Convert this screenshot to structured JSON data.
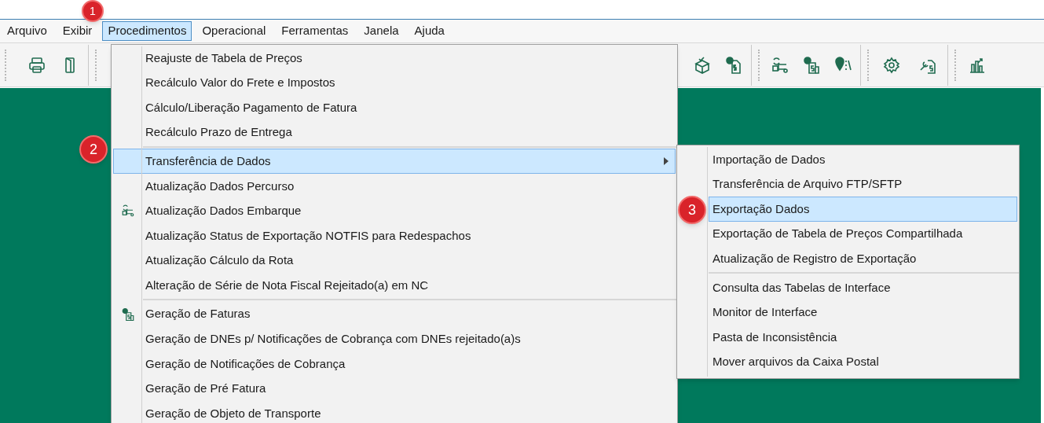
{
  "menu_bar": [
    {
      "label": "Arquivo",
      "selected": false
    },
    {
      "label": "Exibir",
      "selected": false
    },
    {
      "label": "Procedimentos",
      "selected": true
    },
    {
      "label": "Operacional",
      "selected": false
    },
    {
      "label": "Ferramentas",
      "selected": false
    },
    {
      "label": "Janela",
      "selected": false
    },
    {
      "label": "Ajuda",
      "selected": false
    }
  ],
  "menu": {
    "items": [
      {
        "kind": "item",
        "label": "Reajuste de Tabela de Preços",
        "selected": false,
        "has_icon": false,
        "submenu": false
      },
      {
        "kind": "item",
        "label": "Recálculo Valor do Frete e Impostos",
        "selected": false,
        "has_icon": false,
        "submenu": false
      },
      {
        "kind": "item",
        "label": "Cálculo/Liberação Pagamento de Fatura",
        "selected": false,
        "has_icon": false,
        "submenu": false
      },
      {
        "kind": "item",
        "label": "Recálculo Prazo de Entrega",
        "selected": false,
        "has_icon": false,
        "submenu": false
      },
      {
        "kind": "separator"
      },
      {
        "kind": "item",
        "label": "Transferência de Dados",
        "selected": true,
        "has_icon": false,
        "submenu": true
      },
      {
        "kind": "item",
        "label": "Atualização Dados Percurso",
        "selected": false,
        "has_icon": false,
        "submenu": false
      },
      {
        "kind": "item",
        "label": "Atualização Dados Embarque",
        "selected": false,
        "has_icon": true,
        "submenu": false
      },
      {
        "kind": "item",
        "label": "Atualização Status de Exportação NOTFIS para Redespachos",
        "selected": false,
        "has_icon": false,
        "submenu": false
      },
      {
        "kind": "item",
        "label": "Atualização Cálculo da Rota",
        "selected": false,
        "has_icon": false,
        "submenu": false
      },
      {
        "kind": "item",
        "label": "Alteração de Série de Nota Fiscal Rejeitado(a) em NC",
        "selected": false,
        "has_icon": false,
        "submenu": false
      },
      {
        "kind": "separator"
      },
      {
        "kind": "item",
        "label": "Geração de Faturas",
        "selected": false,
        "has_icon": true,
        "submenu": false
      },
      {
        "kind": "item",
        "label": "Geração de DNEs p/ Notificações de Cobrança com DNEs rejeitado(a)s",
        "selected": false,
        "has_icon": false,
        "submenu": false
      },
      {
        "kind": "item",
        "label": "Geração de Notificações de Cobrança",
        "selected": false,
        "has_icon": false,
        "submenu": false
      },
      {
        "kind": "item",
        "label": "Geração de Pré Fatura",
        "selected": false,
        "has_icon": false,
        "submenu": false
      },
      {
        "kind": "item",
        "label": "Geração de Objeto de Transporte",
        "selected": false,
        "has_icon": false,
        "submenu": false
      }
    ]
  },
  "submenu": {
    "items": [
      {
        "kind": "item",
        "label": "Importação de Dados",
        "selected": false
      },
      {
        "kind": "item",
        "label": "Transferência de Arquivo FTP/SFTP",
        "selected": false
      },
      {
        "kind": "item",
        "label": "Exportação Dados",
        "selected": true
      },
      {
        "kind": "item",
        "label": "Exportação de Tabela de Preços Compartilhada",
        "selected": false
      },
      {
        "kind": "item",
        "label": "Atualização de Registro de Exportação",
        "selected": false
      },
      {
        "kind": "separator"
      },
      {
        "kind": "item",
        "label": "Consulta das Tabelas de Interface",
        "selected": false
      },
      {
        "kind": "item",
        "label": "Monitor de Interface",
        "selected": false
      },
      {
        "kind": "item",
        "label": "Pasta de Inconsistência",
        "selected": false
      },
      {
        "kind": "item",
        "label": "Mover arquivos da Caixa Postal",
        "selected": false
      }
    ]
  },
  "callouts": [
    {
      "number": "1"
    },
    {
      "number": "2"
    },
    {
      "number": "3"
    }
  ]
}
